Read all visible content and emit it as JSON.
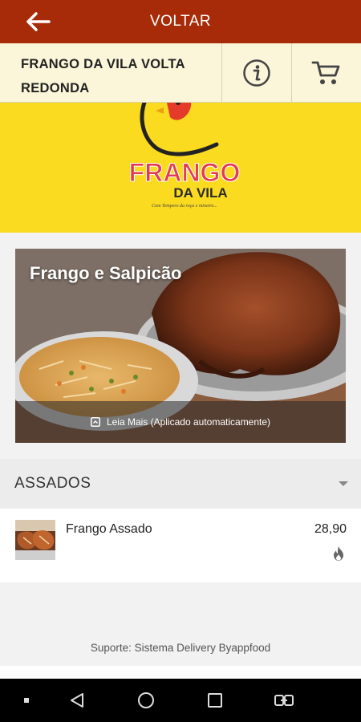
{
  "topbar": {
    "back_icon": "arrow-left-icon",
    "title": "VOLTAR",
    "color": "#a82b09"
  },
  "store": {
    "name": "FRANGO DA VILA VOLTA REDONDA",
    "info_icon": "info-icon",
    "cart_icon": "cart-icon"
  },
  "banner": {
    "background": "#fadb1f",
    "logo_main": "FRANGO",
    "logo_sub": "DA VILA",
    "logo_tagline": "Com Tempero da roça e mineiro..."
  },
  "promo": {
    "title": "Frango e Salpicão",
    "read_more": "Leia Mais (Aplicado automaticamente)",
    "read_more_icon": "expand-icon"
  },
  "category": {
    "title": "ASSADOS",
    "caret_icon": "caret-down-icon"
  },
  "items": [
    {
      "name": "Frango Assado",
      "price": "28,90",
      "badge_icon": "fire-icon"
    }
  ],
  "footer": {
    "support": "Suporte: Sistema Delivery Byappfood"
  },
  "navbar": {
    "icons": [
      "dot-icon",
      "back-triangle-icon",
      "home-circle-icon",
      "recents-square-icon",
      "switch-app-icon"
    ]
  }
}
